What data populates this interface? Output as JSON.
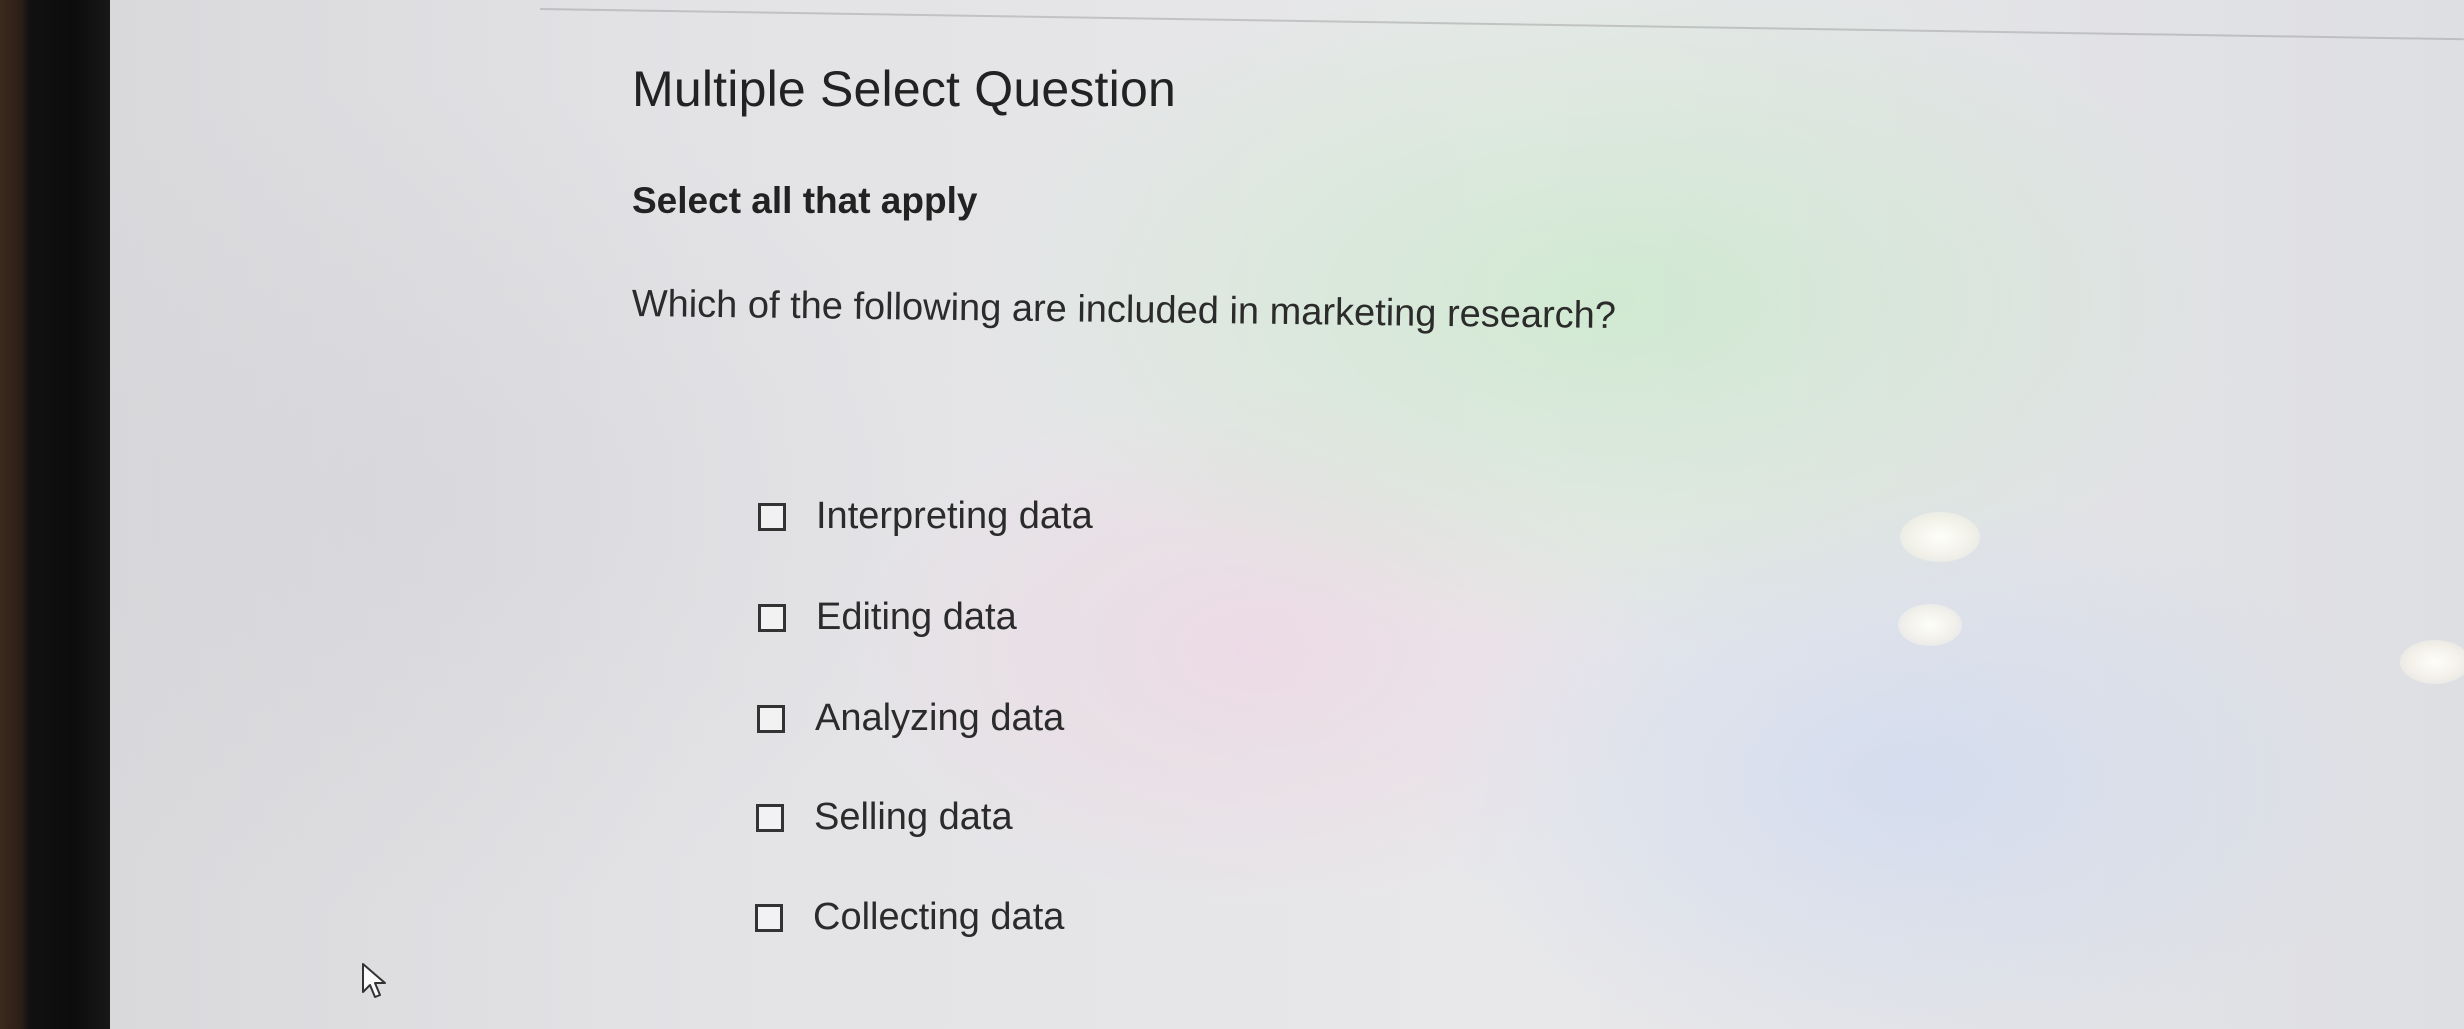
{
  "question": {
    "type_label": "Multiple Select Question",
    "instruction": "Select all that apply",
    "prompt": "Which of the following are included in marketing research?",
    "options": [
      {
        "label": "Interpreting data",
        "checked": false
      },
      {
        "label": "Editing data",
        "checked": false
      },
      {
        "label": "Analyzing data",
        "checked": false
      },
      {
        "label": "Selling data",
        "checked": false
      },
      {
        "label": "Collecting data",
        "checked": false
      }
    ]
  },
  "icons": {
    "cursor": "mouse-pointer-icon"
  }
}
